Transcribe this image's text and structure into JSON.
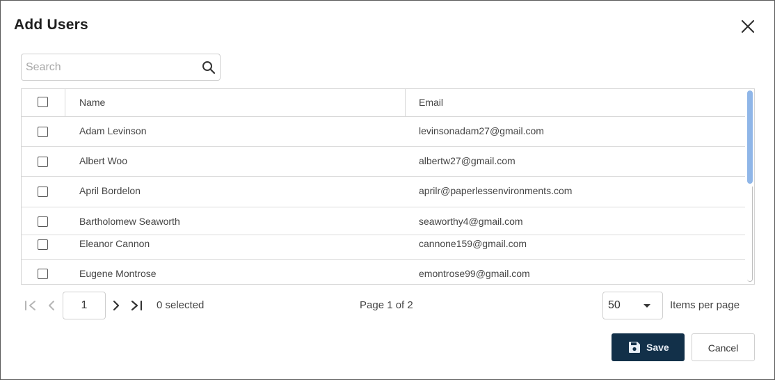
{
  "dialog": {
    "title": "Add Users",
    "close_icon": "close-icon"
  },
  "search": {
    "placeholder": "Search",
    "value": "",
    "icon": "search-icon"
  },
  "table": {
    "columns": [
      "Name",
      "Email"
    ],
    "rows": [
      {
        "name": "Adam Levinson",
        "email": "levinsonadam27@gmail.com",
        "checked": false
      },
      {
        "name": "Albert Woo",
        "email": "albertw27@gmail.com",
        "checked": false
      },
      {
        "name": "April Bordelon",
        "email": "aprilr@paperlessenvironments.com",
        "checked": false
      },
      {
        "name": "Bartholomew Seaworth",
        "email": "seaworthy4@gmail.com",
        "checked": false
      },
      {
        "name": "Eleanor Cannon",
        "email": "cannone159@gmail.com",
        "checked": false
      },
      {
        "name": "Eugene Montrose",
        "email": "emontrose99@gmail.com",
        "checked": false
      }
    ]
  },
  "pagination": {
    "current_page": "1",
    "selected_text": "0 selected",
    "page_text": "Page 1 of 2",
    "items_per_page": "50",
    "items_per_page_label": "Items per page"
  },
  "footer": {
    "save_label": "Save",
    "cancel_label": "Cancel"
  },
  "colors": {
    "save_bg": "#123049",
    "scroll_thumb": "#8fb6e8"
  }
}
